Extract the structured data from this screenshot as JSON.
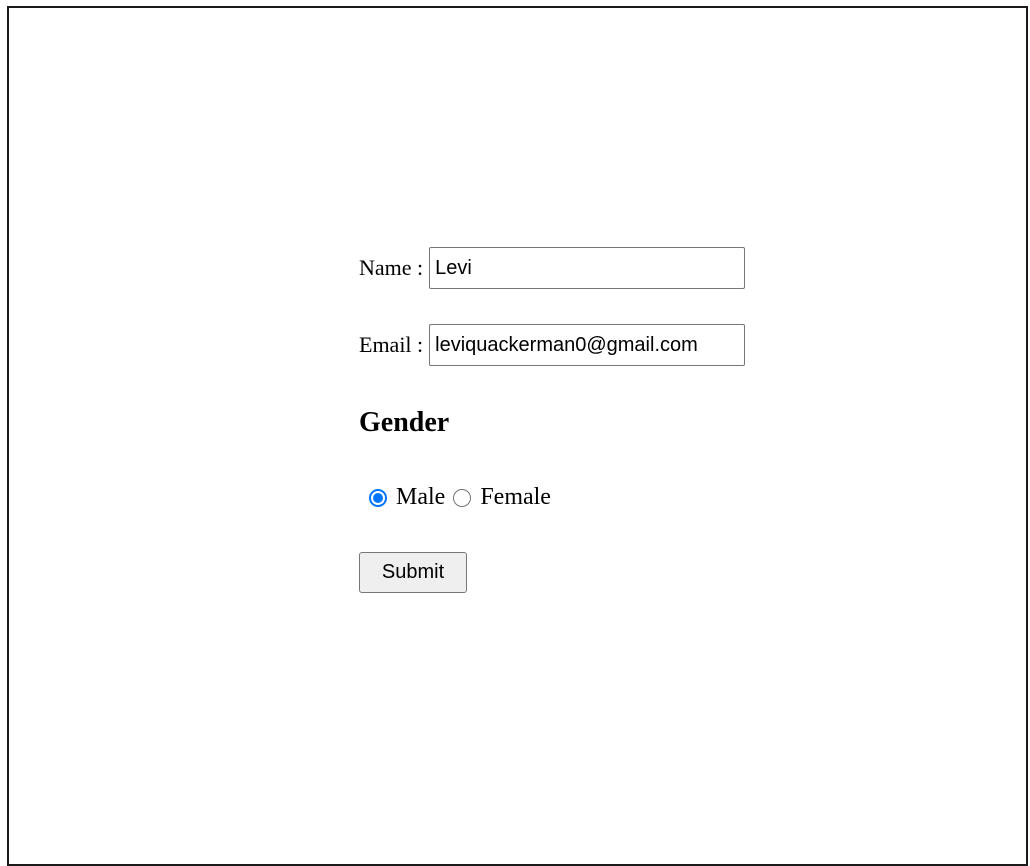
{
  "form": {
    "name_label": "Name :",
    "name_value": "Levi",
    "email_label": "Email :",
    "email_value": "leviquackerman0@gmail.com",
    "gender_heading": "Gender",
    "gender_options": [
      {
        "label": "Male",
        "selected": true
      },
      {
        "label": "Female",
        "selected": false
      }
    ],
    "submit_label": "Submit"
  },
  "colors": {
    "accent": "#0075ff",
    "border": "#767676",
    "button_bg": "#efefef"
  }
}
